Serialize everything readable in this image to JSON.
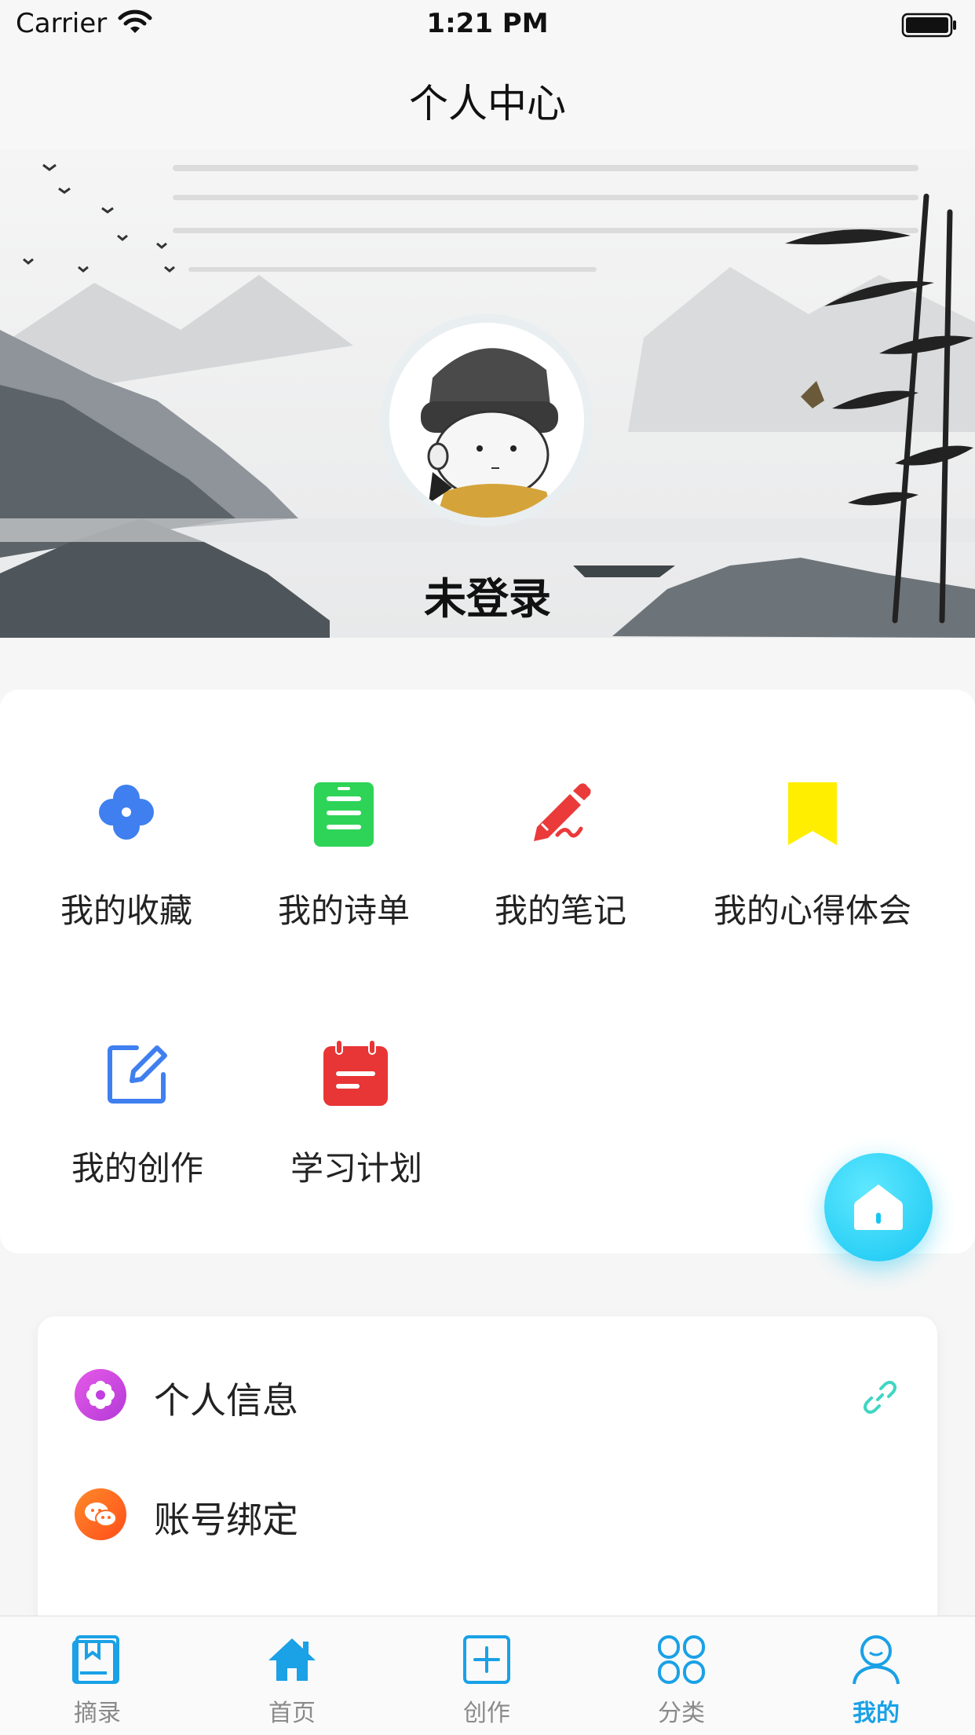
{
  "status": {
    "carrier": "Carrier",
    "time": "1:21 PM"
  },
  "nav": {
    "title": "个人中心"
  },
  "profile": {
    "username": "未登录"
  },
  "grid": [
    {
      "label": "我的收藏",
      "icon": "clover-icon",
      "color": "#3f7ff0"
    },
    {
      "label": "我的诗单",
      "icon": "list-doc-icon",
      "color": "#2ed457"
    },
    {
      "label": "我的笔记",
      "icon": "pen-icon",
      "color": "#ea3a3a"
    },
    {
      "label": "我的心得体会",
      "icon": "bookmark-icon",
      "color": "#ffee00"
    },
    {
      "label": "我的创作",
      "icon": "edit-icon",
      "color": "#3f7ff0"
    },
    {
      "label": "学习计划",
      "icon": "calendar-icon",
      "color": "#e83535"
    }
  ],
  "fab": {
    "icon": "home-icon"
  },
  "settings": [
    {
      "label": "个人信息",
      "icon": "flower-icon",
      "color": "#c13ee0",
      "trailing_icon": "link-icon"
    },
    {
      "label": "账号绑定",
      "icon": "wechat-icon",
      "color": "#ff6a1f"
    }
  ],
  "tabs": [
    {
      "label": "摘录",
      "icon": "book-icon"
    },
    {
      "label": "首页",
      "icon": "home-icon"
    },
    {
      "label": "创作",
      "icon": "plus-square-icon"
    },
    {
      "label": "分类",
      "icon": "grid-icon"
    },
    {
      "label": "我的",
      "icon": "user-icon",
      "active": true
    }
  ],
  "colors": {
    "accent": "#1aa1e6",
    "tab_inactive": "#8a8a8a",
    "fab": "#17c6f2"
  }
}
